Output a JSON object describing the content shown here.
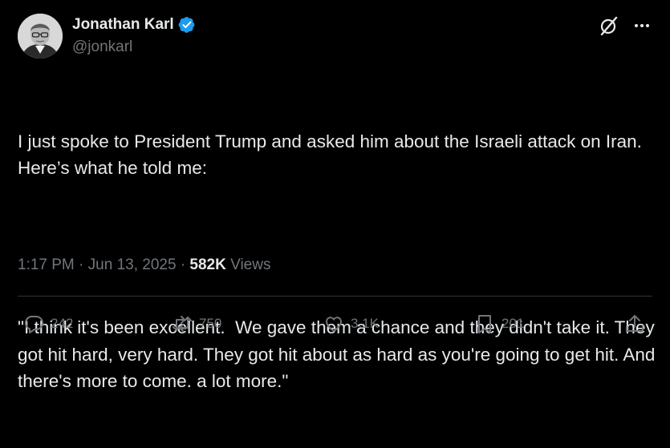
{
  "author": {
    "display_name": "Jonathan Karl",
    "handle": "@jonkarl",
    "verified": true
  },
  "header_icons": [
    "grok-icon",
    "more-options-icon"
  ],
  "post": {
    "paragraphs": [
      "I just spoke to President Trump and asked him about the Israeli attack on Iran. Here’s what he told me:",
      "\"I think it's been excellent.  We gave them a chance and they didn't take it. They got hit hard, very hard. They got hit about as hard as you're going to get hit. And there's more to come. a lot more.\""
    ]
  },
  "meta": {
    "time": "1:17 PM",
    "separator": "·",
    "date": "Jun 13, 2025",
    "views_count": "582K",
    "views_label": "Views"
  },
  "actions": {
    "replies": "242",
    "reposts": "750",
    "likes": "3.1K",
    "bookmarks": "201"
  },
  "colors": {
    "background": "#000000",
    "text": "#e7e9ea",
    "secondary": "#71767b",
    "verified": "#1d9bf0",
    "divider": "#2f3336"
  }
}
